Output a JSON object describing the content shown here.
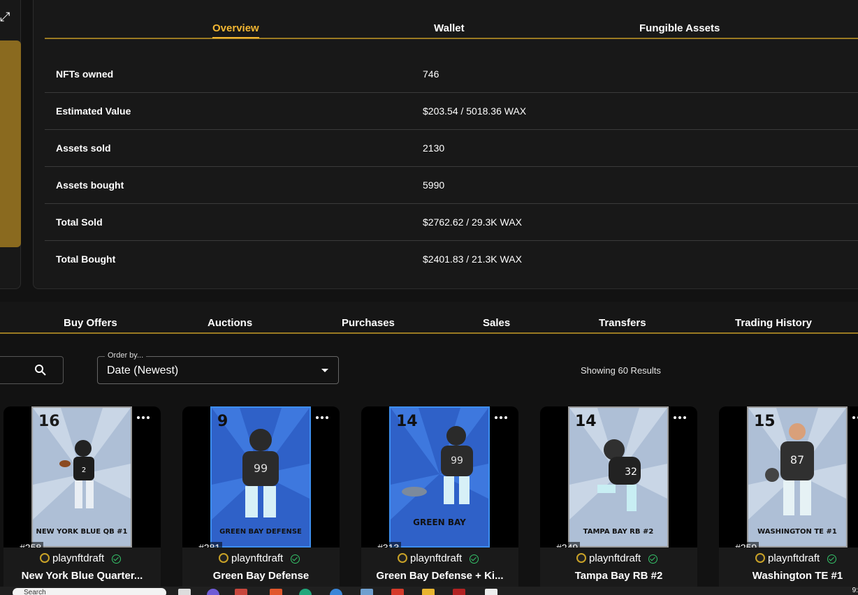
{
  "overview_tabs": [
    "Overview",
    "Wallet",
    "Fungible Assets"
  ],
  "stats": [
    {
      "label": "NFTs owned",
      "value": "746"
    },
    {
      "label": "Estimated Value",
      "value": "$203.54 / 5018.36 WAX"
    },
    {
      "label": "Assets sold",
      "value": "2130"
    },
    {
      "label": "Assets bought",
      "value": "5990"
    },
    {
      "label": "Total Sold",
      "value": "$2762.62 / 29.3K WAX"
    },
    {
      "label": "Total Bought",
      "value": "$2401.83 / 21.3K WAX"
    }
  ],
  "activity_tabs": [
    "Buy Offers",
    "Auctions",
    "Purchases",
    "Sales",
    "Transfers",
    "Trading History"
  ],
  "order": {
    "label": "Order by...",
    "value": "Date (Newest)"
  },
  "results_text": "Showing 60 Results",
  "cards": [
    {
      "mint": "#258",
      "collection": "playnftdraft",
      "title": "New York Blue Quarter...",
      "jersey": "2",
      "number": "16",
      "caption": "NEW YORK BLUE QB #1",
      "style": "gray"
    },
    {
      "mint": "#281",
      "collection": "playnftdraft",
      "title": "Green Bay Defense",
      "jersey": "99",
      "number": "9",
      "caption": "GREEN BAY DEFENSE",
      "style": "blue"
    },
    {
      "mint": "#313",
      "collection": "playnftdraft",
      "title": "Green Bay Defense + Ki...",
      "jersey": "99",
      "number": "14",
      "caption": "GREEN BAY",
      "style": "blue"
    },
    {
      "mint": "#249",
      "collection": "playnftdraft",
      "title": "Tampa Bay RB #2",
      "jersey": "32",
      "number": "14",
      "caption": "TAMPA BAY RB #2",
      "style": "gray"
    },
    {
      "mint": "#259",
      "collection": "playnftdraft",
      "title": "Washington TE #1",
      "jersey": "87",
      "number": "15",
      "caption": "WASHINGTON TE #1",
      "style": "gray"
    }
  ],
  "taskbar": {
    "search_placeholder": "Search",
    "time": "9:"
  }
}
